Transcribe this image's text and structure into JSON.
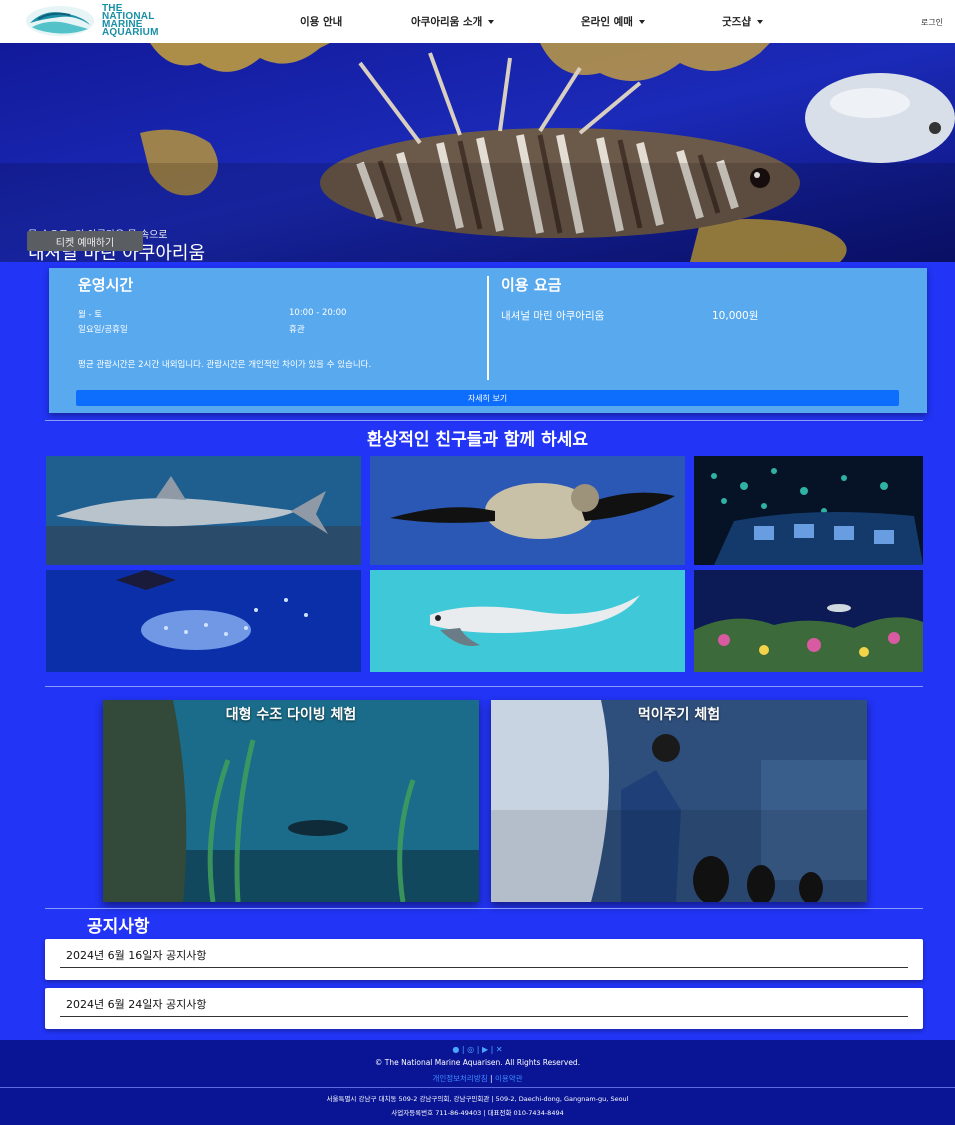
{
  "nav": {
    "logo_lines": [
      "THE",
      "NATIONAL",
      "MARINE",
      "AQUARIUM"
    ],
    "items": [
      {
        "label": "이용 안내",
        "dropdown": false
      },
      {
        "label": "아쿠아리움 소개",
        "dropdown": true
      },
      {
        "label": "온라인 예매",
        "dropdown": true
      },
      {
        "label": "굿즈샵",
        "dropdown": true
      }
    ],
    "login": "로그인"
  },
  "hero": {
    "subtitle": "물 속으로! 더 아름다운 물 속으로",
    "title": "내셔널 마린 아쿠아리움",
    "button": "티켓 예매하기"
  },
  "info": {
    "hours_title": "운영시간",
    "hours": [
      {
        "day": "월 - 토",
        "time": "10:00 - 20:00"
      },
      {
        "day": "일요일/공휴일",
        "time": "휴관"
      }
    ],
    "note": "평균 관람시간은 2시간 내외입니다. 관람시간은 개인적인 차이가 있을 수 있습니다.",
    "fee_title": "이용 요금",
    "fee_name": "내셔널 마린 아쿠아리움",
    "fee_price": "10,000원",
    "detail_button": "자세히 보기"
  },
  "gallery": {
    "title": "환상적인 친구들과 함께 하세요"
  },
  "programs": [
    {
      "label": "대형 수조 다이빙 체험"
    },
    {
      "label": "먹이주기 체험"
    }
  ],
  "notices": {
    "title": "공지사항",
    "items": [
      "2024년 6월 16일자 공지사항",
      "2024년 6월 24일자 공지사항"
    ]
  },
  "footer": {
    "social_icons": [
      "facebook-icon",
      "instagram-icon",
      "youtube-icon",
      "x-icon"
    ],
    "copyright": "© The National Marine Aquarisen. All Rights Reserved.",
    "privacy": "개인정보처리방침",
    "terms": "이용약관",
    "address": "서울특별시 강남구 대치동 509-2 강남구의회, 강남구민회관 | 509-2, Daechi-dong, Gangnam-gu, Seoul",
    "business": "사업자등록번호 711-86-49403 | 대표전화 010-7434-8494"
  },
  "colors": {
    "page_bg": "#2234f5",
    "info_card": "#58a9ee",
    "button_primary": "#0d6efd",
    "footer_bg": "#0a1596",
    "link": "#3d8bff"
  }
}
